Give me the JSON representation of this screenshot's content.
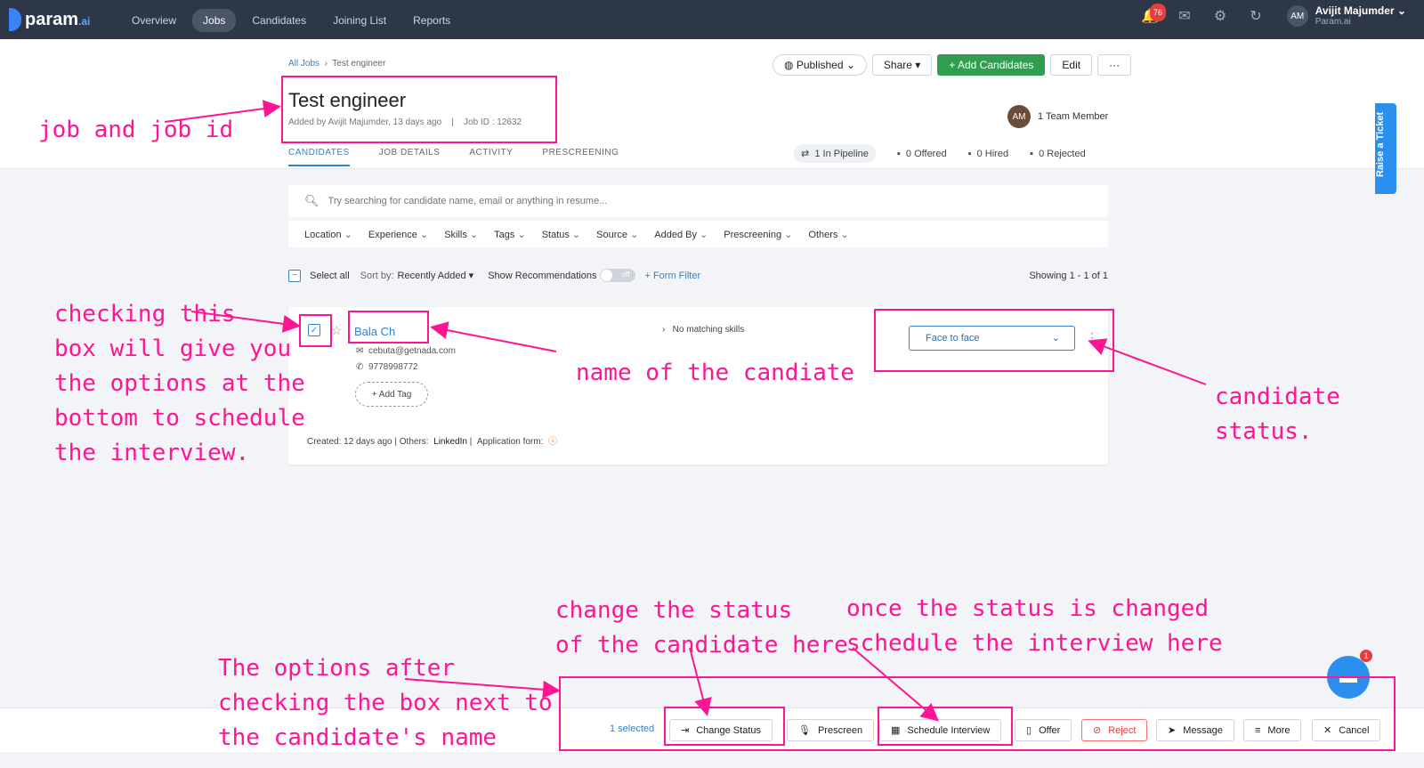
{
  "app": {
    "brand": "param",
    "brand_suffix": ".ai"
  },
  "nav": [
    "Overview",
    "Jobs",
    "Candidates",
    "Joining List",
    "Reports"
  ],
  "notifications_count": "76",
  "user": {
    "initials": "AM",
    "name": "Avijit Majumder",
    "org": "Param.ai"
  },
  "breadcrumb": {
    "root": "All Jobs",
    "current": "Test engineer"
  },
  "job": {
    "title": "Test engineer",
    "added_by": "Added by Avijit Majumder, 13 days ago",
    "sep": "|",
    "job_id": "Job ID : 12632"
  },
  "actions": {
    "published": "Published",
    "share": "Share",
    "add_candidates": "+ Add Candidates",
    "edit": "Edit",
    "more": "···"
  },
  "team": {
    "initials": "AM",
    "label": "1 Team Member"
  },
  "tabs": [
    "CANDIDATES",
    "JOB DETAILS",
    "ACTIVITY",
    "PRESCREENING"
  ],
  "stats": {
    "pipeline": "1 In Pipeline",
    "offered": "0 Offered",
    "hired": "0 Hired",
    "rejected": "0 Rejected"
  },
  "raise_ticket": "Raise a Ticket",
  "search": {
    "placeholder": "Try searching for candidate name, email or anything in resume..."
  },
  "filters": [
    "Location",
    "Experience",
    "Skills",
    "Tags",
    "Status",
    "Source",
    "Added By",
    "Prescreening",
    "Others"
  ],
  "list": {
    "select_all": "Select all",
    "sort_prefix": "Sort by:",
    "sort_value": "Recently Added",
    "show_recs": "Show Recommendations",
    "toggle": "off",
    "form_filter": "+ Form Filter",
    "showing": "Showing 1 - 1 of 1"
  },
  "candidate": {
    "name": "Bala Ch",
    "email": "cebuta@getnada.com",
    "phone": "9778998772",
    "add_tag": "+ Add Tag",
    "skills": "No matching skills",
    "created": "Created: 12 days ago",
    "others_label": "Others:",
    "others_value": "LinkedIn",
    "app_form": "Application form:",
    "status": "Face to face"
  },
  "bottom": {
    "selected": "1 selected",
    "change_status": "Change Status",
    "prescreen": "Prescreen",
    "schedule": "Schedule Interview",
    "offer": "Offer",
    "reject": "Reject",
    "message": "Message",
    "more": "More",
    "cancel": "Cancel"
  },
  "chat_badge": "1",
  "annotations": {
    "job": "job and job id",
    "checkbox": "checking this\nbox will give you\nthe options at the\nbottom to schedule\nthe interview.",
    "name": "name of the candiate",
    "status": "candidate\nstatus.",
    "change": "change the status\nof the candidate here",
    "schedule": "once the status is changed\nschedule the interview here",
    "options": "The options after\nchecking the box next to\nthe candidate's name"
  },
  "colors": {
    "annotation": "#ff1493",
    "accent": "#3182ce",
    "green": "#2f9e4f"
  }
}
